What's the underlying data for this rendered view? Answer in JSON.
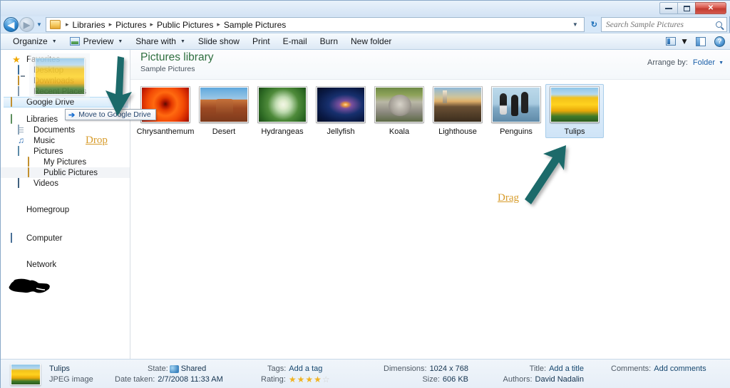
{
  "window": {
    "title_buttons": {
      "minimize": "—",
      "maximize": "❐",
      "close": "✕"
    }
  },
  "address_bar": {
    "back_icon": "◀",
    "forward_icon": "▶",
    "history_caret": "▼",
    "breadcrumb": [
      "Libraries",
      "Pictures",
      "Public Pictures",
      "Sample Pictures"
    ],
    "breadcrumb_separator": "▸",
    "dropdown_caret": "▼",
    "refresh_label": "↻",
    "search": {
      "placeholder": "Search Sample Pictures",
      "value": ""
    }
  },
  "command_bar": {
    "items": [
      {
        "label": "Organize",
        "has_caret": true,
        "has_icon": false
      },
      {
        "label": "Preview",
        "has_caret": true,
        "has_icon": true
      },
      {
        "label": "Share with",
        "has_caret": true,
        "has_icon": false
      },
      {
        "label": "Slide show",
        "has_caret": false,
        "has_icon": false
      },
      {
        "label": "Print",
        "has_caret": false,
        "has_icon": false
      },
      {
        "label": "E-mail",
        "has_caret": false,
        "has_icon": false
      },
      {
        "label": "Burn",
        "has_caret": false,
        "has_icon": false
      },
      {
        "label": "New folder",
        "has_caret": false,
        "has_icon": false
      }
    ],
    "caret_glyph": "▼",
    "right_icons": [
      "view-icon",
      "view-caret-icon",
      "preview-pane-icon",
      "help-icon"
    ],
    "help_glyph": "?"
  },
  "navigation_pane": {
    "items": [
      {
        "label": "Favorites",
        "icon": "star-icon",
        "level": 0,
        "selected": false,
        "group_start": false
      },
      {
        "label": "Desktop",
        "icon": "desktop-icon",
        "level": 1,
        "selected": false,
        "group_start": false
      },
      {
        "label": "Downloads",
        "icon": "downloads-folder-icon",
        "level": 1,
        "selected": false,
        "group_start": false
      },
      {
        "label": "Recent Places",
        "icon": "recent-places-icon",
        "level": 1,
        "selected": false,
        "group_start": false
      },
      {
        "label": "Google Drive",
        "icon": "google-drive-folder-icon",
        "level": 1,
        "selected": true,
        "group_start": false
      },
      {
        "label": "Libraries",
        "icon": "libraries-icon",
        "level": 0,
        "selected": false,
        "group_start": true
      },
      {
        "label": "Documents",
        "icon": "documents-icon",
        "level": 1,
        "selected": false,
        "group_start": false
      },
      {
        "label": "Music",
        "icon": "music-icon",
        "level": 1,
        "selected": false,
        "group_start": false
      },
      {
        "label": "Pictures",
        "icon": "pictures-icon",
        "level": 1,
        "selected": false,
        "group_start": false
      },
      {
        "label": "My Pictures",
        "icon": "folder-icon",
        "level": 2,
        "selected": false,
        "group_start": false
      },
      {
        "label": "Public Pictures",
        "icon": "folder-icon",
        "level": 2,
        "selected": false,
        "group_start": false,
        "highlighted": true
      },
      {
        "label": "Videos",
        "icon": "videos-icon",
        "level": 1,
        "selected": false,
        "group_start": false
      },
      {
        "label": "Homegroup",
        "icon": "homegroup-icon",
        "level": 0,
        "selected": false,
        "group_start": true
      },
      {
        "label": "",
        "icon": "redacted-scribble",
        "level": 0,
        "selected": false,
        "group_start": true
      },
      {
        "label": "Computer",
        "icon": "computer-icon",
        "level": 0,
        "selected": false,
        "group_start": true
      },
      {
        "label": "Network",
        "icon": "network-icon",
        "level": 0,
        "selected": false,
        "group_start": true
      }
    ]
  },
  "library_header": {
    "title": "Pictures library",
    "subtitle": "Sample Pictures",
    "arrange_label": "Arrange by:",
    "arrange_value": "Folder",
    "arrange_caret": "▼"
  },
  "files": [
    {
      "name": "Chrysanthemum",
      "art": "art-chrys",
      "selected": false
    },
    {
      "name": "Desert",
      "art": "art-desert",
      "selected": false
    },
    {
      "name": "Hydrangeas",
      "art": "art-hydr",
      "selected": false
    },
    {
      "name": "Jellyfish",
      "art": "art-jelly",
      "selected": false
    },
    {
      "name": "Koala",
      "art": "art-koala",
      "selected": false
    },
    {
      "name": "Lighthouse",
      "art": "art-light",
      "selected": false
    },
    {
      "name": "Penguins",
      "art": "art-peng",
      "selected": false
    },
    {
      "name": "Tulips",
      "art": "art-tulip",
      "selected": true
    }
  ],
  "drag_overlay": {
    "tooltip_text": "Move to Google Drive",
    "tooltip_arrow": "➔"
  },
  "annotations": [
    {
      "name": "drop",
      "label": "Drop",
      "color": "#d79b2a"
    },
    {
      "name": "drag",
      "label": "Drag",
      "color": "#d79b2a"
    }
  ],
  "annotation_arrow_color": "#1d6b6b",
  "details_pane": {
    "file_name": "Tulips",
    "file_type": "JPEG image",
    "state_label": "State:",
    "state_value": "Shared",
    "date_taken_label": "Date taken:",
    "date_taken_value": "2/7/2008 11:33 AM",
    "tags_label": "Tags:",
    "tags_value": "Add a tag",
    "rating_label": "Rating:",
    "rating_filled": 4,
    "rating_total": 5,
    "dimensions_label": "Dimensions:",
    "dimensions_value": "1024 x 768",
    "size_label": "Size:",
    "size_value": "606 KB",
    "title_label": "Title:",
    "title_value": "Add a title",
    "authors_label": "Authors:",
    "authors_value": "David Nadalin",
    "comments_label": "Comments:",
    "comments_value": "Add comments"
  }
}
